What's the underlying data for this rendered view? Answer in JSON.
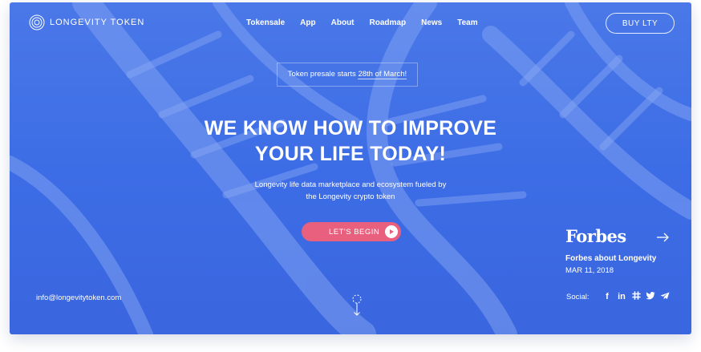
{
  "brand": {
    "name": "LONGEVITY  TOKEN",
    "icon": "concentric-circles-logo"
  },
  "nav": {
    "items": [
      "Tokensale",
      "App",
      "About",
      "Roadmap",
      "News",
      "Team"
    ]
  },
  "header": {
    "buy_label": "BUY LTY"
  },
  "presale": {
    "prefix": "Token presale starts ",
    "date": "28th of March!"
  },
  "hero": {
    "headline_line1": "WE KNOW HOW TO IMPROVE",
    "headline_line2": "YOUR LIFE TODAY!",
    "sub_line1": "Longevity life data marketplace and ecosystem fueled by",
    "sub_line2": "the Longevity crypto token",
    "cta_label": "LET'S BEGIN"
  },
  "footer": {
    "email": "info@longevitytoken.com"
  },
  "press": {
    "logo_text": "Forbes",
    "title": "Forbes about Longevity",
    "date": "MAR 11, 2018"
  },
  "social": {
    "label": "Social:",
    "icons": [
      "facebook-icon",
      "linkedin-icon",
      "slack-icon",
      "twitter-icon",
      "telegram-icon"
    ]
  },
  "colors": {
    "background": "#3d6de6",
    "cta": "#e8607d",
    "text": "#ffffff"
  }
}
